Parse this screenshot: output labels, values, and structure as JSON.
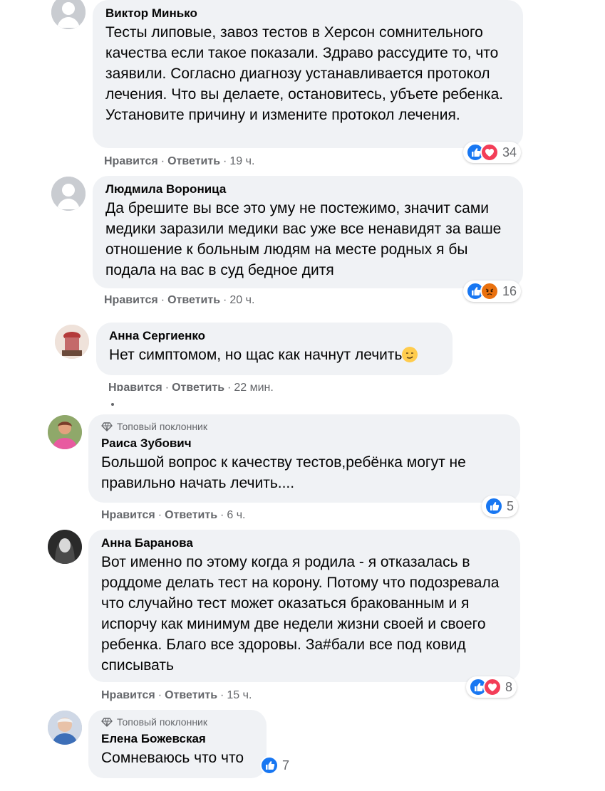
{
  "actions": {
    "like": "Нравится",
    "reply": "Ответить",
    "separator": "·"
  },
  "badge_label": "Топовый поклонник",
  "comments": [
    {
      "author": "Виктор Минько",
      "text": "Тесты липовые, завоз тестов в Херсон сомнительного качества если такое показали. Здраво рассудите то, что заявили. Согласно диагнозу устанавливается протокол лечения. Что вы делаете, остановитесь, убъете ребенка. Установите причину и измените протокол лечения.",
      "time": "19 ч.",
      "reaction_count": "34",
      "reactions": [
        "like",
        "love"
      ]
    },
    {
      "author": "Людмила Вороница",
      "text": "Да брешите вы все это уму не постежимо, значит сами медики заразили медики вас уже все ненавидят за ваше отношение к больным людям на месте родных я бы подала на вас в суд бедное дитя",
      "time": "20 ч.",
      "reaction_count": "16",
      "reactions": [
        "like",
        "angry"
      ]
    },
    {
      "author": "Анна Сергиенко",
      "text": "Нет симптомом, но щас как начнут лечить",
      "time": "22 мин.",
      "reactions": []
    },
    {
      "author": "Раиса Зубович",
      "text": "Большой вопрос к качеству тестов,ребёнка могут не правильно начать лечить....",
      "time": "6 ч.",
      "reaction_count": "5",
      "reactions": [
        "like"
      ]
    },
    {
      "author": "Анна Баранова",
      "text": "Вот именно по этому когда я родила - я отказалась в роддоме делать тест на корону. Потому что подозревала что случайно тест может оказаться бракованным и я испорчу как минимум две недели жизни своей и своего ребенка. Благо все здоровы. За#бали все под ковид списывать",
      "time": "15 ч.",
      "reaction_count": "8",
      "reactions": [
        "like",
        "love"
      ]
    },
    {
      "author": "Елена Божевская",
      "text": "Сомневаюсь что что",
      "reaction_count": "7",
      "reactions": [
        "like"
      ]
    }
  ],
  "colors": {
    "bubble": "#f0f2f5",
    "meta": "#65676b",
    "like": "#1877f2",
    "love": "#f33e58",
    "angry": "#e9710f"
  }
}
